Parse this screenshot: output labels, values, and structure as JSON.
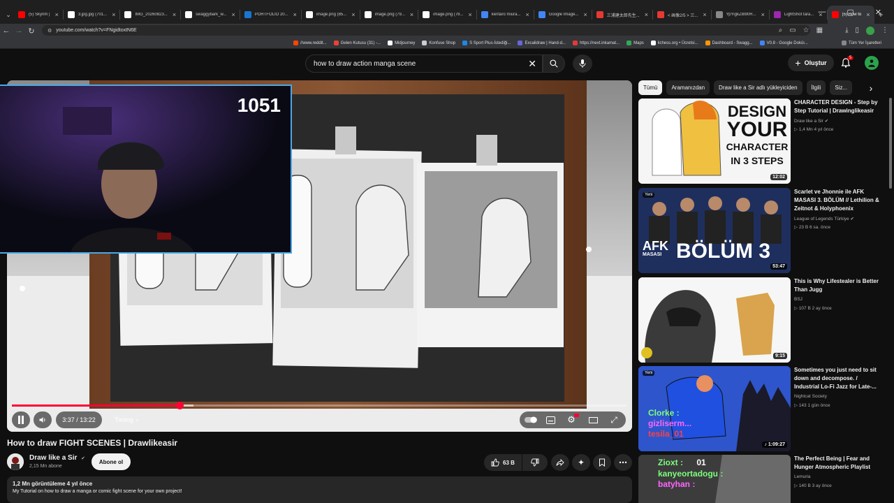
{
  "browser": {
    "tabs": [
      {
        "title": "(5) Skyrim |",
        "color": "#ff0000",
        "active": false
      },
      {
        "title": "3.jpg.jpg (701...",
        "color": "#ffffff",
        "active": false
      },
      {
        "title": "IMG_20260823...",
        "color": "#ffffff",
        "active": false
      },
      {
        "title": "swaggybark_w...",
        "color": "#ffffff",
        "active": false
      },
      {
        "title": "PORTFOLIO 20...",
        "color": "#1976d2",
        "active": false
      },
      {
        "title": "image.png (85...",
        "color": "#ffffff",
        "active": false
      },
      {
        "title": "image.png (79...",
        "color": "#ffffff",
        "active": false
      },
      {
        "title": "image.png (78...",
        "color": "#ffffff",
        "active": false
      },
      {
        "title": "kentaro miura...",
        "color": "#4285f4",
        "active": false
      },
      {
        "title": "Google Image...",
        "color": "#4285f4",
        "active": false
      },
      {
        "title": "三浦建太郎先生...",
        "color": "#e53935",
        "active": false
      },
      {
        "title": "< 画像2/5 > 三...",
        "color": "#e53935",
        "active": false
      },
      {
        "title": "YpYigkZI890R...",
        "color": "#888888",
        "active": false
      },
      {
        "title": "LightShot tara...",
        "color": "#9c27b0",
        "active": false
      },
      {
        "title": "(5) How to",
        "color": "#ff0000",
        "active": true
      }
    ],
    "url": "youtube.com/watch?v=FNgidtoxtN6E",
    "bookmarks": [
      {
        "label": "//www.reddit...",
        "color": "#ff4500"
      },
      {
        "label": "Gelen Kutusu (31) -...",
        "color": "#ea4335"
      },
      {
        "label": "Midjourney",
        "color": "#ffffff"
      },
      {
        "label": "Konfuse Shop",
        "color": "#cccccc"
      },
      {
        "label": "S Sport Plus-İstediği...",
        "color": "#1e88e5"
      },
      {
        "label": "Excalidraw | Hand-d...",
        "color": "#6965db"
      },
      {
        "label": "https://next.inkamat...",
        "color": "#e53935"
      },
      {
        "label": "Maps",
        "color": "#34a853"
      },
      {
        "label": "lichess.org • Ücretsi...",
        "color": "#ffffff"
      },
      {
        "label": "Dashboard - Swagg...",
        "color": "#ff9800"
      },
      {
        "label": "V0.8 - Google Doküı...",
        "color": "#4285f4"
      }
    ],
    "all_bookmarks": "Tüm Yer İşaretleri"
  },
  "youtube": {
    "search_query": "how to draw action manga scene",
    "create_label": "Oluştur",
    "notif_count": "5",
    "player": {
      "current_time": "3:37",
      "duration": "13:22",
      "time_display": "3:37 / 13:22",
      "timing_label": "Timing",
      "progress_fraction": 0.273,
      "buffered_fraction": 0.295,
      "cam_counter": "1051"
    },
    "video": {
      "title": "How to draw FIGHT SCENES | Drawlikeasir",
      "channel": "Draw like a Sir",
      "subscribers": "2,15 Mn abone",
      "subscribe_label": "Abone ol",
      "likes": "63 B",
      "views_date": "1,2 Mn görüntüleme  4 yıl önce",
      "description": "My Tutorial on how to draw a manga or comic fight scene for your own project!"
    },
    "chips": [
      "Tümü",
      "Aramanızdan",
      "Draw like a Sir adlı yükleyiciden",
      "İlgili",
      "Siz..."
    ],
    "recommendations": [
      {
        "title": "CHARACTER DESIGN - Step by Step Tutorial | Drawinglikeasir",
        "channel": "Draw like a Sir",
        "views": "1,4 Mn",
        "age": "4 yıl önce",
        "meta": "1,4 Mn  4 yıl önce",
        "duration": "12:02",
        "new": false,
        "thumb_text_1": "DESIGN",
        "thumb_text_2": "YOUR",
        "thumb_text_3": "CHARACTER",
        "thumb_text_4": "IN 3 STEPS"
      },
      {
        "title": "Scarlet ve Jhonnie ile AFK MASASI 3. BÖLÜM // Lethilion & Zeitnot & Holyphoenix",
        "channel": "League of Legends Türkiye",
        "views": "23 B",
        "age": "6 sa. önce",
        "meta": "23 B  6 sa. önce",
        "duration": "53:47",
        "new": true,
        "new_label": "Yeni",
        "thumb_text_1": "AFK",
        "thumb_text_2": "MASASI",
        "thumb_text_3": "BÖLÜM 3"
      },
      {
        "title": "This is Why Lifestealer is Better Than Jugg",
        "channel": "BSJ",
        "views": "107 B",
        "age": "2 ay önce",
        "meta": "107 B  2 ay önce",
        "duration": "9:15",
        "new": false
      },
      {
        "title": "Sometimes you just need to sit down and decompose. / Industrial Lo-Fi Jazz for Late-...",
        "channel": "Nightcat Society",
        "views": "143",
        "age": "1 gün önce",
        "meta": "143  1 gün önce",
        "duration": "1:09:27",
        "new": true,
        "new_label": "Yeni",
        "thumb_text_1": "Clorke :",
        "thumb_text_2": "gizliserm...",
        "thumb_text_3": "tesila_01"
      },
      {
        "title": "The Perfect Being | Fear and Hunger Atmospheric Playlist",
        "channel": "Lemuria",
        "views": "140 B",
        "age": "3 ay önce",
        "meta": "140 B  3 ay önce",
        "new": false,
        "thumb_text_1": "Zioxt :",
        "thumb_text_1b": "01",
        "thumb_text_2": "kanyeortadogu :",
        "thumb_text_3": "batyhan :"
      }
    ]
  },
  "colors": {
    "accent": "#ff0033",
    "bg": "#0f0f0f",
    "chip_bg": "#272727"
  }
}
